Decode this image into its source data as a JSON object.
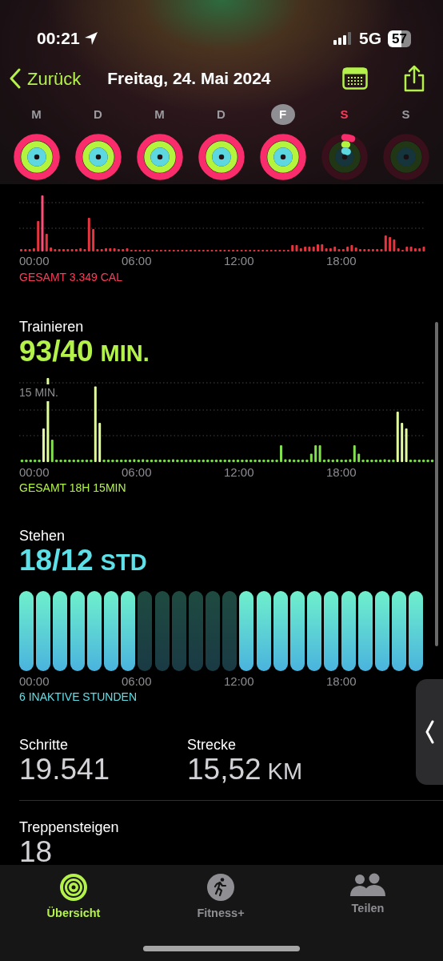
{
  "status_bar": {
    "time": "00:21",
    "network": "5G",
    "battery": "57"
  },
  "nav": {
    "back": "Zurück",
    "title": "Freitag, 24. Mai 2024"
  },
  "days": [
    {
      "label": "M",
      "selected": false,
      "today": false,
      "rings": [
        {
          "kind": "move",
          "level": 1
        },
        {
          "kind": "exercise",
          "level": 1
        },
        {
          "kind": "stand",
          "level": 1
        }
      ]
    },
    {
      "label": "D",
      "selected": false,
      "today": false,
      "rings": [
        {
          "kind": "move",
          "level": 1
        },
        {
          "kind": "exercise",
          "level": 1
        },
        {
          "kind": "stand",
          "level": 1
        }
      ]
    },
    {
      "label": "M",
      "selected": false,
      "today": false,
      "rings": [
        {
          "kind": "move",
          "level": 1
        },
        {
          "kind": "exercise",
          "level": 1
        },
        {
          "kind": "stand",
          "level": 1
        }
      ]
    },
    {
      "label": "D",
      "selected": false,
      "today": false,
      "rings": [
        {
          "kind": "move",
          "level": 1
        },
        {
          "kind": "exercise",
          "level": 1
        },
        {
          "kind": "stand",
          "level": 1
        }
      ]
    },
    {
      "label": "F",
      "selected": true,
      "today": false,
      "rings": [
        {
          "kind": "move",
          "level": 1
        },
        {
          "kind": "exercise",
          "level": 1
        },
        {
          "kind": "stand",
          "level": 1
        }
      ]
    },
    {
      "label": "S",
      "selected": false,
      "today": true,
      "rings": [
        {
          "kind": "move",
          "level": 0.06
        },
        {
          "kind": "exercise",
          "level": 0.03
        },
        {
          "kind": "stand",
          "level": 0.08
        }
      ]
    },
    {
      "label": "S",
      "selected": false,
      "today": false,
      "rings": [
        {
          "kind": "move"
        },
        {
          "kind": "exercise"
        },
        {
          "kind": "stand"
        }
      ]
    }
  ],
  "move": {
    "x_labels": [
      "00:00",
      "06:00",
      "12:00",
      "18:00"
    ],
    "total": "GESAMT 3.349 CAL"
  },
  "exercise": {
    "title": "Trainieren",
    "value": "93/40",
    "unit": "MIN.",
    "axis_label": "15 MIN.",
    "x_labels": [
      "00:00",
      "06:00",
      "12:00",
      "18:00"
    ],
    "total": "GESAMT 18H 15MIN"
  },
  "stand": {
    "title": "Stehen",
    "value": "18/12",
    "unit": "STD",
    "hours": [
      {
        "active": true
      },
      {
        "active": true
      },
      {
        "active": true
      },
      {
        "active": true
      },
      {
        "active": true
      },
      {
        "active": true
      },
      {
        "active": true
      },
      {
        "active": false
      },
      {
        "active": false
      },
      {
        "active": false
      },
      {
        "active": false
      },
      {
        "active": false
      },
      {
        "active": false
      },
      {
        "active": true
      },
      {
        "active": true
      },
      {
        "active": true
      },
      {
        "active": true
      },
      {
        "active": true
      },
      {
        "active": true
      },
      {
        "active": true
      },
      {
        "active": true
      },
      {
        "active": true
      },
      {
        "active": true
      },
      {
        "active": true
      }
    ],
    "x_labels": [
      "00:00",
      "06:00",
      "12:00",
      "18:00"
    ],
    "summary": "6 INAKTIVE STUNDEN"
  },
  "stats": [
    {
      "label": "Schritte",
      "value": "19.541"
    },
    {
      "label": "Strecke",
      "value": "15,52",
      "unit": "KM"
    }
  ],
  "stairs": {
    "label": "Treppensteigen",
    "value": "18"
  },
  "tab_bar": [
    {
      "label": "Übersicht",
      "selected": true,
      "kind": "rings"
    },
    {
      "label": "Fitness+",
      "selected": false,
      "kind": "runner"
    },
    {
      "label": "Teilen",
      "selected": false,
      "kind": "people"
    }
  ]
}
